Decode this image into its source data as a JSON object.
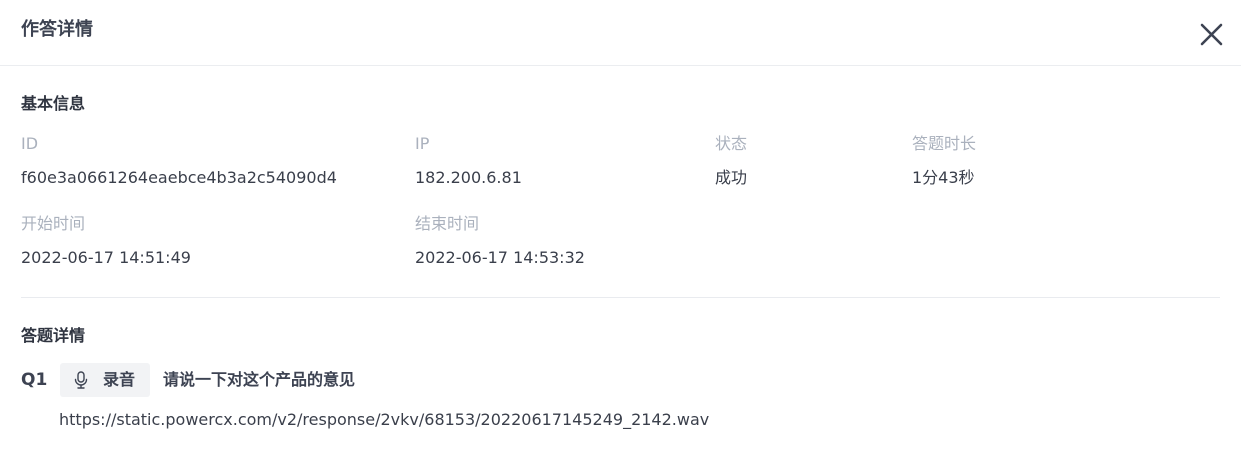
{
  "dialog": {
    "title": "作答详情"
  },
  "basic_info": {
    "section_title": "基本信息",
    "fields": [
      {
        "label": "ID",
        "value": "f60e3a0661264eaebce4b3a2c54090d4"
      },
      {
        "label": "IP",
        "value": "182.200.6.81"
      },
      {
        "label": "状态",
        "value": "成功"
      },
      {
        "label": "答题时长",
        "value": "1分43秒"
      },
      {
        "label": "开始时间",
        "value": "2022-06-17 14:51:49"
      },
      {
        "label": "结束时间",
        "value": "2022-06-17 14:53:32"
      }
    ]
  },
  "answer_detail": {
    "section_title": "答题详情",
    "questions": [
      {
        "index": "Q1",
        "type_label": "录音",
        "type_icon": "microphone-icon",
        "text": "请说一下对这个产品的意见",
        "answer": "https://static.powercx.com/v2/response/2vkv/68153/20220617145249_2142.wav"
      }
    ]
  },
  "icons": {
    "close": "close-icon"
  },
  "colors": {
    "label": "#aab1bd",
    "text": "#3a3f4b",
    "title": "#3d4352",
    "tag_bg": "#f2f3f5",
    "divider": "#e9ebef"
  }
}
